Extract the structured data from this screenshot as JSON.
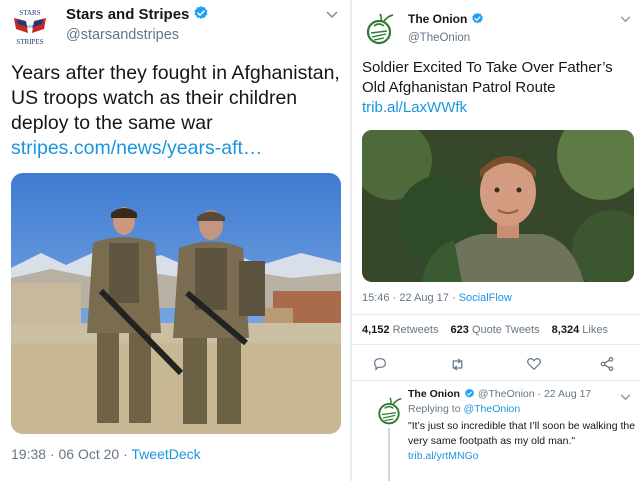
{
  "left_tweet": {
    "avatar_text": {
      "line1": "STARS",
      "line2": "AND",
      "line3": "STRIPES"
    },
    "author_name": "Stars and Stripes",
    "handle": "@starsandstripes",
    "text": "Years after they fought in Afghanistan, US troops watch as their children deploy to the same war",
    "link": "stripes.com/news/years-aft…",
    "time": "19:38",
    "date": "06 Oct 20",
    "source": "TweetDeck",
    "separator": "·",
    "colors": {
      "link": "#1b95e0",
      "verified": "#1da1f2",
      "secondary_text": "#657786"
    },
    "icons": {
      "verified": "verified-badge-icon",
      "menu": "chevron-down-icon"
    }
  },
  "right_tweet": {
    "author_name": "The Onion",
    "handle": "@TheOnion",
    "text": "Soldier Excited To Take Over Father’s Old Afghanistan Patrol Route",
    "link": "trib.al/LaxWWfk",
    "time": "15:46",
    "date": "22 Aug 17",
    "source": "SocialFlow",
    "separator": "·",
    "retweets_count": "4,152",
    "retweets_label": "Retweets",
    "quotes_count": "623",
    "quotes_label": "Quote Tweets",
    "likes_count": "8,324",
    "likes_label": "Likes",
    "colors": {
      "onion_green": "#2e7d32",
      "link": "#1b95e0"
    },
    "icons": {
      "logo": "onion-logo-icon",
      "reply": "reply-icon",
      "retweet": "retweet-icon",
      "like": "heart-icon",
      "share": "share-icon"
    }
  },
  "reply_tweet": {
    "author_name": "The Onion",
    "handle": "@TheOnion",
    "date": "22 Aug 17",
    "separator": "·",
    "replying_prefix": "Replying to",
    "replying_to": "@TheOnion",
    "text": "\"It’s just so incredible that I’ll soon be walking the very same footpath as my old man.\"",
    "link": "trib.al/yrtMNGo"
  }
}
